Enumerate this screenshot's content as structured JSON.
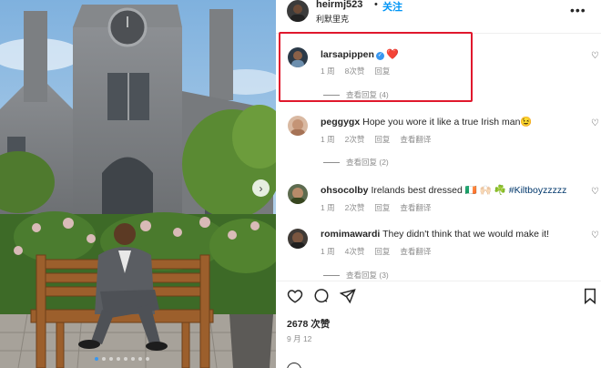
{
  "post": {
    "header": {
      "username": "heirmj523",
      "separator": "•",
      "follow_label": "关注",
      "location": "利默里克",
      "more_icon": "more-horizontal-icon"
    },
    "comments": [
      {
        "username": "larsapippen",
        "verified": true,
        "text": "",
        "emoji": "❤️",
        "time": "1 周",
        "likes": "8次赞",
        "reply_label": "回复",
        "translate_label": "",
        "view_replies": "查看回复 (4)"
      },
      {
        "username": "peggygx",
        "verified": false,
        "text": "Hope you wore it like a true Irish man😉",
        "time": "1 周",
        "likes": "2次赞",
        "reply_label": "回复",
        "translate_label": "查看翻译",
        "view_replies": "查看回复 (2)"
      },
      {
        "username": "ohsocolby",
        "verified": false,
        "text": "Irelands best dressed 🇮🇪 🙌🏻 ☘️",
        "hashtag": "#Kiltboyzzzzz",
        "time": "1 周",
        "likes": "2次赞",
        "reply_label": "回复",
        "translate_label": "查看翻译",
        "view_replies": ""
      },
      {
        "username": "romimawardi",
        "verified": false,
        "text": "They didn't think that we would make it!",
        "time": "1 周",
        "likes": "4次赞",
        "reply_label": "回复",
        "translate_label": "查看翻译",
        "view_replies": "查看回复 (3)"
      }
    ],
    "actions": {
      "like_icon": "heart-icon",
      "comment_icon": "comment-icon",
      "share_icon": "send-icon",
      "save_icon": "bookmark-icon"
    },
    "like_count": "2678 次赞",
    "date": "9 月 12",
    "carousel": {
      "slide_count": 8,
      "active_index": 0,
      "next_icon": "chevron-right-icon"
    },
    "colors": {
      "highlight": "#e0182d",
      "link_blue": "#0095f6",
      "verified_blue": "#3897f0",
      "muted": "#8e8e8e"
    }
  }
}
